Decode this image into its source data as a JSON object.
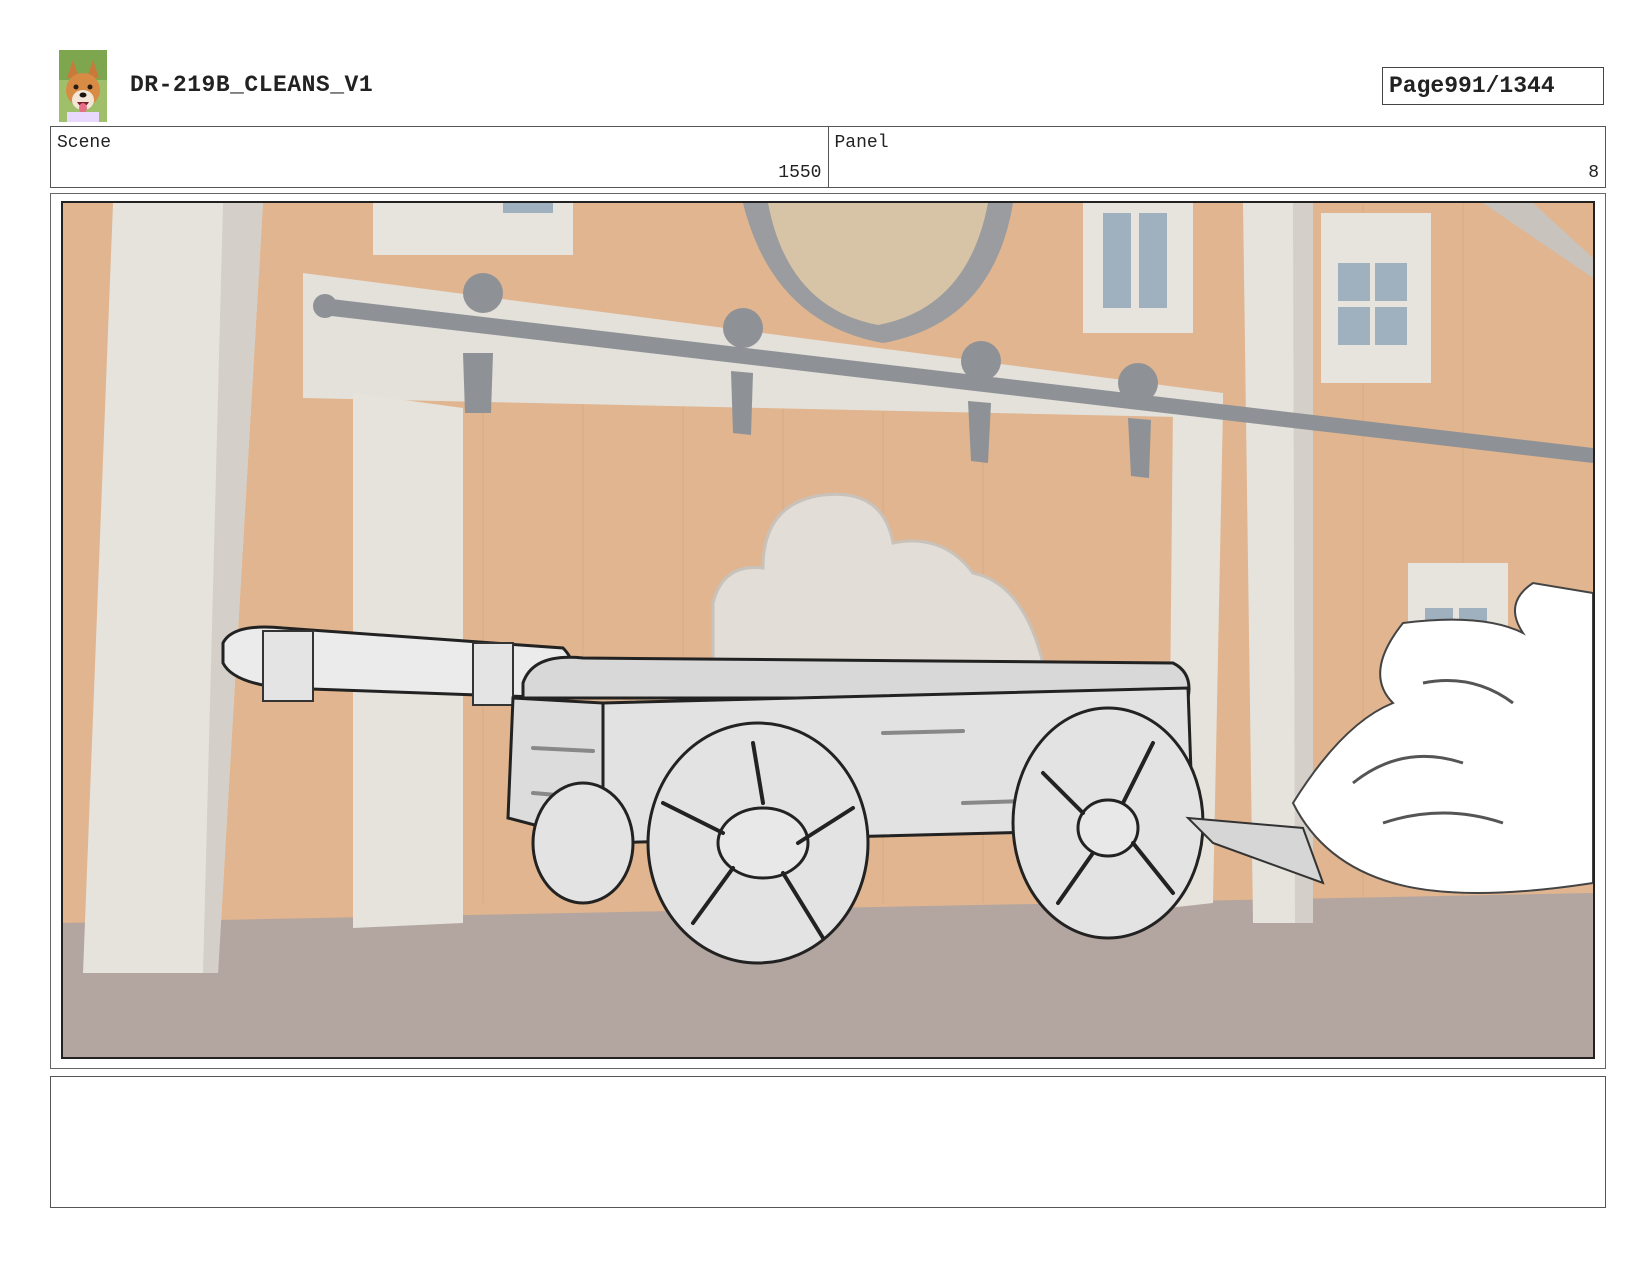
{
  "header": {
    "title": "DR-219B_CLEANS_V1",
    "page_label": "Page",
    "page_number": "991/1344"
  },
  "info": {
    "scene_label": "Scene",
    "scene_value": "1550",
    "panel_label": "Panel",
    "panel_value": "8"
  },
  "panel_art": {
    "icon": "storyboard-frame-wagon-icon",
    "colors": {
      "wall": "#e0b58f",
      "trim": "#e4e0da",
      "ground": "#b3a5a0",
      "rail": "#8e9297",
      "window": "#9fb0bf"
    }
  },
  "notes": {
    "text": ""
  }
}
